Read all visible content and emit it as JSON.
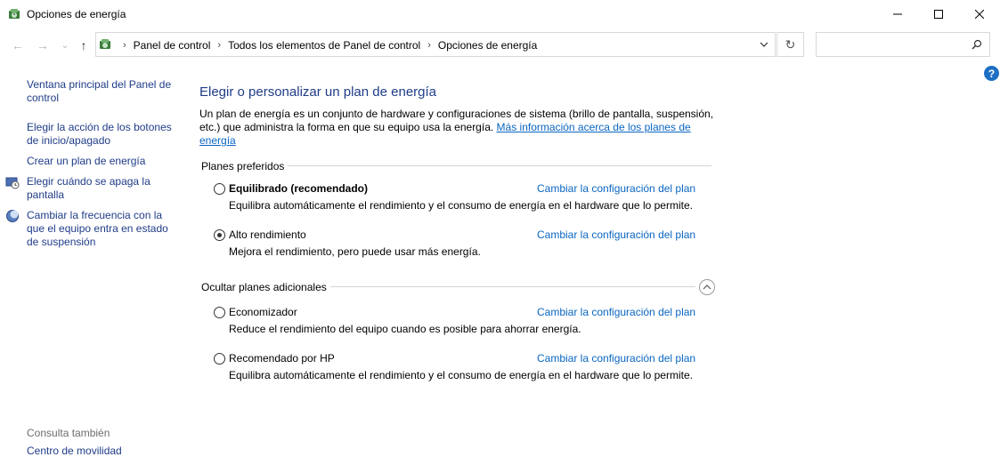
{
  "window": {
    "title": "Opciones de energía",
    "icon": "power-options-icon"
  },
  "address": {
    "crumbs": [
      "Panel de control",
      "Todos los elementos de Panel de control",
      "Opciones de energía"
    ],
    "search_placeholder": ""
  },
  "sidebar": {
    "main_link": "Ventana principal del Panel de control",
    "links": [
      {
        "label": "Elegir la acción de los botones de inicio/apagado",
        "icon": ""
      },
      {
        "label": "Crear un plan de energía",
        "icon": ""
      },
      {
        "label": "Elegir cuándo se apaga la pantalla",
        "icon": "display-timer-icon"
      },
      {
        "label": "Cambiar la frecuencia con la que el equipo entra en estado de suspensión",
        "icon": "sleep-moon-icon"
      }
    ],
    "see_also": "Consulta también",
    "see_also_next": "Centro de movilidad"
  },
  "main": {
    "title": "Elegir o personalizar un plan de energía",
    "description": "Un plan de energía es un conjunto de hardware y configuraciones de sistema (brillo de pantalla, suspensión, etc.) que administra la forma en que su equipo usa la energía.",
    "more_info_link": "Más información acerca de los planes de energía",
    "preferred_label": "Planes preferidos",
    "hidden_label": "Ocultar planes adicionales",
    "change_link": "Cambiar la configuración del plan",
    "preferred_plans": [
      {
        "name": "Equilibrado (recomendado)",
        "desc": "Equilibra automáticamente el rendimiento y el consumo de energía en el hardware que lo permite.",
        "checked": false,
        "bold": true
      },
      {
        "name": "Alto rendimiento",
        "desc": "Mejora el rendimiento, pero puede usar más energía.",
        "checked": true,
        "bold": false
      }
    ],
    "additional_plans": [
      {
        "name": "Economizador",
        "desc": "Reduce el rendimiento del equipo cuando es posible para ahorrar energía.",
        "checked": false,
        "bold": false
      },
      {
        "name": "Recomendado por HP",
        "desc": "Equilibra automáticamente el rendimiento y el consumo de energía en el hardware que lo permite.",
        "checked": false,
        "bold": false
      }
    ]
  },
  "colors": {
    "link_dark": "#1f3c88",
    "link": "#0a66c2",
    "help": "#1e6fc4"
  }
}
